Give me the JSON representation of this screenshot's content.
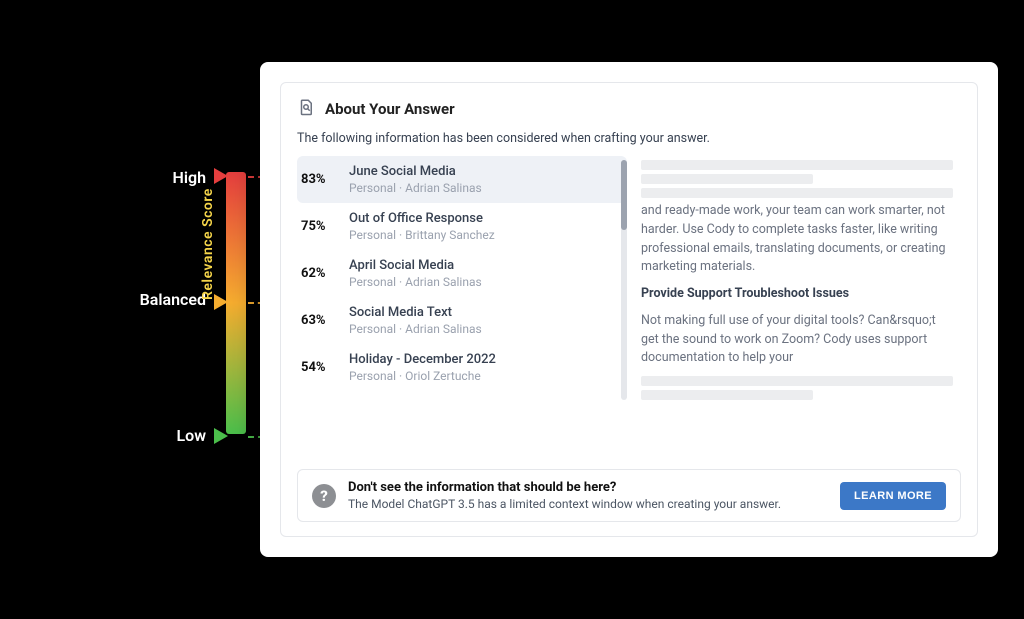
{
  "relevance": {
    "axis_label": "Relevance Score",
    "high": "High",
    "balanced": "Balanced",
    "low": "Low"
  },
  "panel": {
    "title": "About Your Answer",
    "subtext": "The following information has been considered when crafting your answer."
  },
  "items": [
    {
      "pct": "83%",
      "title": "June Social Media",
      "sub": "Personal · Adrian Salinas",
      "selected": true
    },
    {
      "pct": "75%",
      "title": "Out of Office Response",
      "sub": "Personal · Brittany Sanchez",
      "selected": false
    },
    {
      "pct": "62%",
      "title": "April Social Media",
      "sub": "Personal · Adrian Salinas",
      "selected": false
    },
    {
      "pct": "63%",
      "title": "Social Media Text",
      "sub": "Personal · Adrian Salinas",
      "selected": false
    },
    {
      "pct": "54%",
      "title": "Holiday - December 2022",
      "sub": "Personal · Oriol Zertuche",
      "selected": false
    }
  ],
  "preview": {
    "para1": " and ready-made work, your team can work smarter, not harder. Use Cody to complete tasks faster, like writing professional emails, translating documents, or creating marketing materials.",
    "heading": "Provide Support Troubleshoot Issues",
    "para2": "Not making full use of your digital tools? Can&rsquo;t get the sound to work on Zoom? Cody uses support documentation to help your"
  },
  "foot": {
    "heading": "Don't see the information that should be here?",
    "text": "The Model ChatGPT 3.5 has a limited context window when creating your answer.",
    "button": "LEARN MORE"
  }
}
